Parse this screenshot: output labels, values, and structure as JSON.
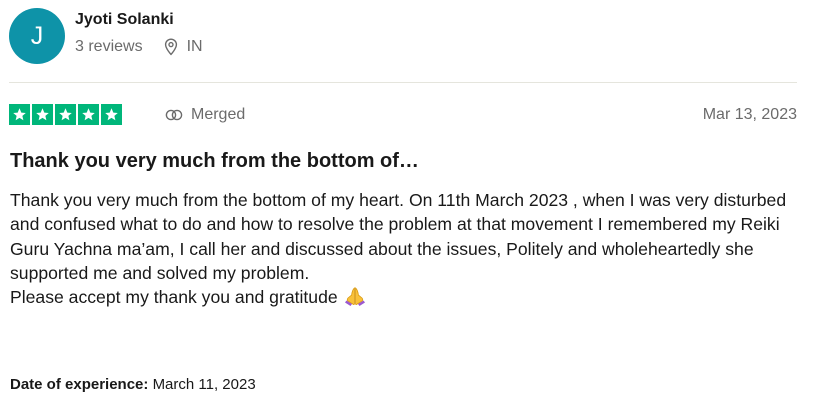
{
  "reviewer": {
    "initial": "J",
    "name": "Jyoti Solanki",
    "reviews_count": "3 reviews",
    "country": "IN",
    "avatar_color": "#0e93a8"
  },
  "review": {
    "rating": 5,
    "star_color": "#00b67a",
    "status_label": "Merged",
    "date": "Mar 13, 2023",
    "title": "Thank you very much from the bottom of…",
    "body_line_1": "Thank you very much from the bottom of my heart. On 11th March 2023 , when I was very disturbed and confused what to do and how to resolve the problem at that movement I remembered my Reiki Guru Yachna ma’am, I call her and discussed about the issues, Politely and wholeheartedly she supported me and solved my problem.",
    "body_line_2": "Please accept my thank you and gratitude",
    "emoji": "folded-hands-icon",
    "experience_label": "Date of experience:",
    "experience_date": "March 11, 2023"
  },
  "icons": {
    "location": "location-pin-icon",
    "merged": "merged-rings-icon",
    "star": "star-icon"
  }
}
